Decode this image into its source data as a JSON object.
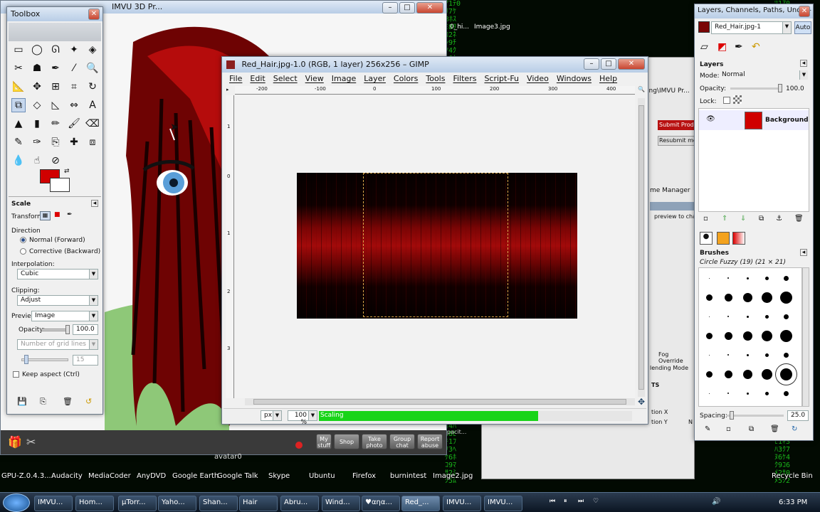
{
  "colors": {
    "accent_red": "#d00000",
    "progress_green": "#19d419",
    "matrix_green": "#1fd41f"
  },
  "top_window": {
    "title": "IMVU 3D Pr..."
  },
  "background_labels": {
    "hi": "0_hi...",
    "image3": "Image3.jpg",
    "imvu_path": "ing\\IMVU Pr...",
    "submit": "Submit Produ...",
    "resubmit": "Resubmit mod...",
    "manager": "me Manager",
    "preview": "preview to chan...",
    "fog": "Fog Override",
    "blend": "lending Mode",
    "ts": "TS",
    "tion_x": "tion X",
    "tion_y": "tion Y",
    "n_label": "N",
    "pacity": "pacit..."
  },
  "toolbox": {
    "title": "Toolbox",
    "tool_icons": [
      "rect-select-icon",
      "ellipse-select-icon",
      "free-select-icon",
      "fuzzy-select-icon",
      "color-select-icon",
      "scissors-icon",
      "foreground-select-icon",
      "paths-icon",
      "color-picker-icon",
      "zoom-icon",
      "measure-icon",
      "move-icon",
      "align-icon",
      "crop-icon",
      "rotate-icon",
      "scale-icon",
      "shear-icon",
      "perspective-icon",
      "flip-icon",
      "text-icon",
      "bucket-fill-icon",
      "blend-icon",
      "pencil-icon",
      "paintbrush-icon",
      "eraser-icon",
      "airbrush-icon",
      "ink-icon",
      "clone-icon",
      "heal-icon",
      "perspective-clone-icon",
      "blur-icon",
      "smudge-icon",
      "dodge-burn-icon"
    ],
    "tool_glyphs": [
      "▭",
      "◯",
      "ᘏ",
      "✦",
      "◈",
      "✂",
      "☗",
      "✒",
      "⁄",
      "🔍",
      "📐",
      "✥",
      "⊞",
      "⌗",
      "↻",
      "⧉",
      "◇",
      "◺",
      "⇔",
      "A",
      "▲",
      "▮",
      "✏",
      "🖌",
      "⌫",
      "✎",
      "✑",
      "⎘",
      "✚",
      "⧈",
      "💧",
      "☝",
      "⊘"
    ],
    "options": {
      "section_title": "Scale",
      "transform_label": "Transform:",
      "direction_label": "Direction",
      "dir_normal": "Normal (Forward)",
      "dir_corrective": "Corrective (Backward)",
      "interpolation_label": "Interpolation:",
      "interpolation_value": "Cubic",
      "clipping_label": "Clipping:",
      "clipping_value": "Adjust",
      "preview_label": "Preview:",
      "preview_value": "Image",
      "opacity_label": "Opacity:",
      "opacity_value": "100.0",
      "grid_value": "Number of grid lines",
      "grid_count": "15",
      "keep_aspect": "Keep aspect  (Ctrl)"
    }
  },
  "avatar": {
    "name": "avatar0",
    "buttons": [
      "My stuff",
      "Shop",
      "Take photo",
      "Group chat",
      "Report abuse"
    ]
  },
  "gimp": {
    "title": "Red_Hair.jpg-1.0 (RGB, 1 layer) 256x256 – GIMP",
    "menu": [
      "File",
      "Edit",
      "Select",
      "View",
      "Image",
      "Layer",
      "Colors",
      "Tools",
      "Filters",
      "Script-Fu",
      "Video",
      "Windows",
      "Help"
    ],
    "ruler_x": [
      "-200",
      "-100",
      "0",
      "100",
      "200",
      "300",
      "400"
    ],
    "ruler_y": [
      "1",
      "0",
      "1",
      "2",
      "3"
    ],
    "unit": "px",
    "zoom": "100 %",
    "status": "Scaling",
    "progress": 0.7
  },
  "layers_dialog": {
    "title": "Layers, Channels, Paths, Undo – B...",
    "image_combo": "Red_Hair.jpg-1",
    "auto_btn": "Auto",
    "section": "Layers",
    "mode_label": "Mode:",
    "mode_value": "Normal",
    "opacity_label": "Opacity:",
    "opacity_value": "100.0",
    "lock_label": "Lock:",
    "layer_name": "Background",
    "brushes_title": "Brushes",
    "brush_name": "Circle Fuzzy (19) (21 × 21)",
    "spacing_label": "Spacing:",
    "spacing_value": "25.0"
  },
  "desktop_icons": [
    "GPU-Z.0.4.3....",
    "Audacity",
    "MediaCoder",
    "AnyDVD",
    "Google Earth",
    "Google Talk",
    "Skype",
    "Ubuntu",
    "Firefox",
    "burnintest",
    "Image2.jpg",
    "Recycle Bin"
  ],
  "taskbar": {
    "tasks": [
      "IMVU...",
      "Hom...",
      "µTorr...",
      "Yaho...",
      "Shan...",
      "Hair",
      "Abru...",
      "Wind...",
      "♥αηα...",
      "Red_...",
      "IMVU...",
      "IMVU..."
    ],
    "time": "6:33 PM"
  }
}
